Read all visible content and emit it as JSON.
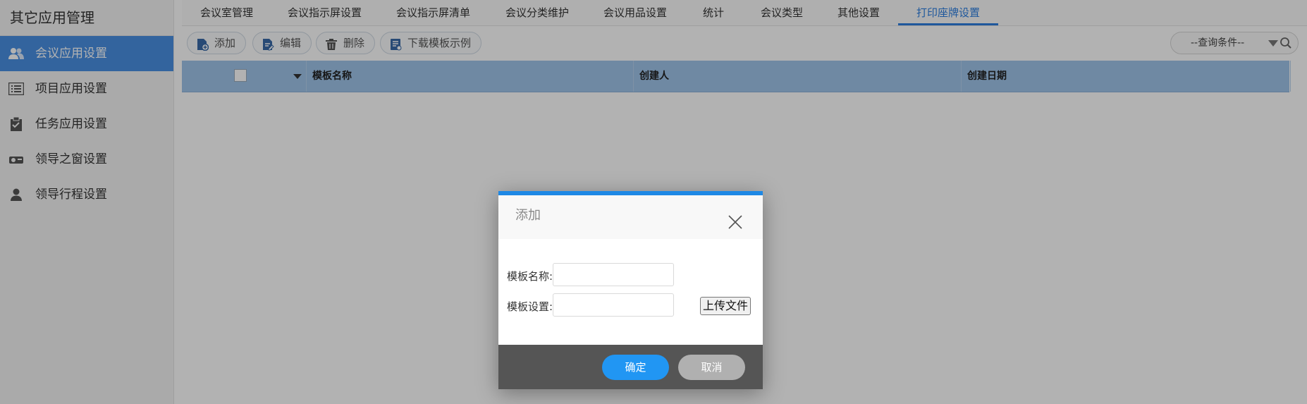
{
  "sidebar": {
    "title": "其它应用管理",
    "items": [
      {
        "label": "会议应用设置",
        "icon": "users-icon",
        "active": true
      },
      {
        "label": "项目应用设置",
        "icon": "list-icon"
      },
      {
        "label": "任务应用设置",
        "icon": "clipboard-icon"
      },
      {
        "label": "领导之窗设置",
        "icon": "projector-icon"
      },
      {
        "label": "领导行程设置",
        "icon": "person-icon"
      }
    ]
  },
  "tabs": [
    {
      "label": "会议室管理"
    },
    {
      "label": "会议指示屏设置"
    },
    {
      "label": "会议指示屏清单"
    },
    {
      "label": "会议分类维护"
    },
    {
      "label": "会议用品设置"
    },
    {
      "label": "统计"
    },
    {
      "label": "会议类型"
    },
    {
      "label": "其他设置"
    },
    {
      "label": "打印座牌设置",
      "active": true
    }
  ],
  "toolbar": {
    "add": "添加",
    "edit": "编辑",
    "delete": "删除",
    "download": "下载模板示例",
    "query_placeholder": "--查询条件--"
  },
  "table": {
    "columns": [
      "模板名称",
      "创建人",
      "创建日期"
    ]
  },
  "modal": {
    "title": "添加",
    "name_label": "模板名称:",
    "setting_label": "模板设置:",
    "name_value": "",
    "setting_value": "",
    "upload_label": "上传文件",
    "ok_label": "确定",
    "cancel_label": "取消"
  },
  "colors": {
    "accent": "#1e88e5",
    "sidebar_active": "#4a90e2",
    "table_header": "#9fc4ea",
    "footer": "#555555"
  }
}
